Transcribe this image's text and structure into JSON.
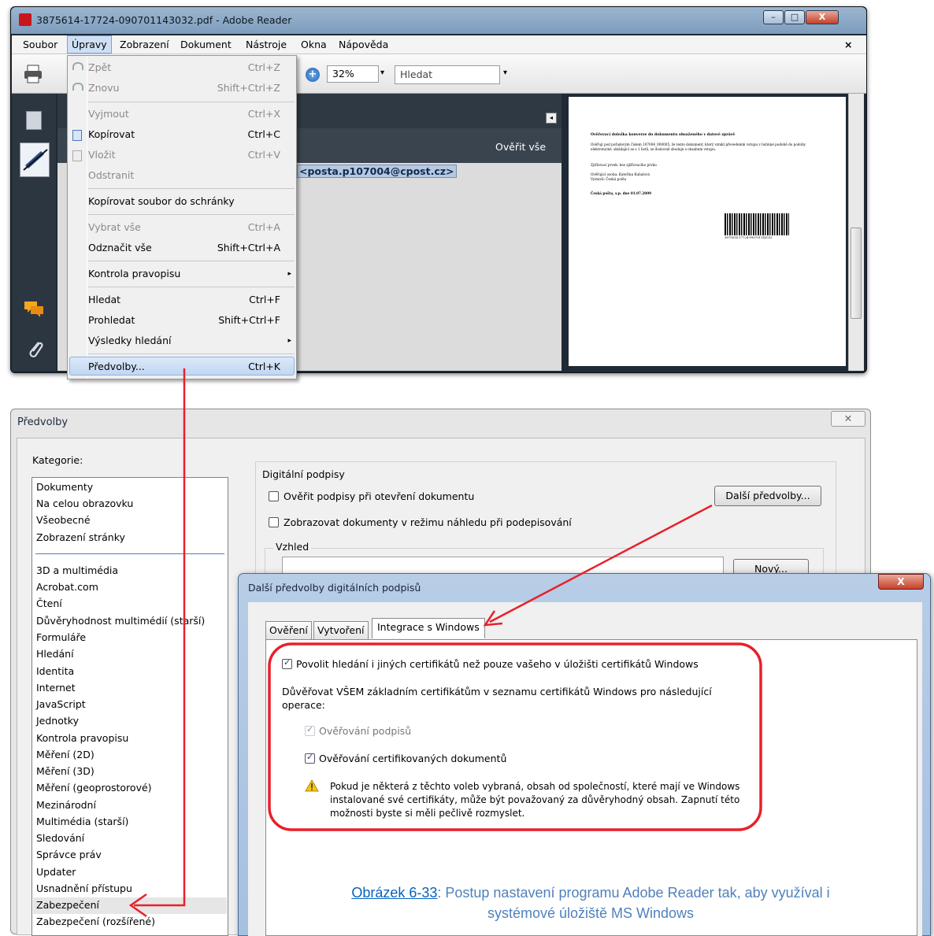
{
  "reader": {
    "title": "3875614-17724-090701143032.pdf - Adobe Reader",
    "controls": {
      "minimize": "–",
      "maximize": "□",
      "close": "X"
    },
    "menubar": [
      "Soubor",
      "Úpravy",
      "Zobrazení",
      "Dokument",
      "Nástroje",
      "Okna",
      "Nápověda"
    ],
    "doc_close": "×",
    "zoom": "32%",
    "search_placeholder": "Hledat",
    "verify_all": "Ověřit vše",
    "signer_email": "<posta.p107004@cpost.cz>",
    "pdf": {
      "heading": "Ověřovací doložka konverze do dokumentu obsaženého v datové zprávě",
      "para": "Ověřuji pod pořadovým číslem 107004_000005, že tento dokument, který vznikl převedením vstupu v listinné podobě do podoby elektronické, skládající se z 1 listů, se doslovně shoduje s obsahem vstupu.",
      "line1": "Zjišťovací prvek: bez zjišťovacího prvku",
      "line2": "Ověřující osoba: Kateřina Kubalová",
      "line3": "Vystavil: Česká pošta",
      "line4": "Česká pošta, s.p. dne 01.07.2009",
      "barcode": "3875614-17724-090701143032"
    }
  },
  "edit_menu": {
    "items": [
      {
        "label": "Zpět",
        "shortcut": "Ctrl+Z",
        "disabled": true
      },
      {
        "label": "Znovu",
        "shortcut": "Shift+Ctrl+Z",
        "disabled": true
      },
      {
        "label": "Vyjmout",
        "shortcut": "Ctrl+X",
        "disabled": true
      },
      {
        "label": "Kopírovat",
        "shortcut": "Ctrl+C",
        "disabled": false
      },
      {
        "label": "Vložit",
        "shortcut": "Ctrl+V",
        "disabled": true
      },
      {
        "label": "Odstranit",
        "shortcut": "",
        "disabled": true
      },
      {
        "label": "Kopírovat soubor do schránky",
        "shortcut": "",
        "disabled": false
      },
      {
        "label": "Vybrat vše",
        "shortcut": "Ctrl+A",
        "disabled": true
      },
      {
        "label": "Odznačit vše",
        "shortcut": "Shift+Ctrl+A",
        "disabled": false
      },
      {
        "label": "Kontrola pravopisu",
        "shortcut": "▸",
        "disabled": false
      },
      {
        "label": "Hledat",
        "shortcut": "Ctrl+F",
        "disabled": false
      },
      {
        "label": "Prohledat",
        "shortcut": "Shift+Ctrl+F",
        "disabled": false
      },
      {
        "label": "Výsledky hledání",
        "shortcut": "▸",
        "disabled": false
      },
      {
        "label": "Předvolby...",
        "shortcut": "Ctrl+K",
        "disabled": false
      }
    ]
  },
  "preferences": {
    "title": "Předvolby",
    "close": "✕",
    "categories_label": "Kategorie:",
    "categories_top": [
      "Dokumenty",
      "Na celou obrazovku",
      "Všeobecné",
      "Zobrazení stránky"
    ],
    "categories": [
      "3D a multimédia",
      "Acrobat.com",
      "Čtení",
      "Důvěryhodnost multimédií (starší)",
      "Formuláře",
      "Hledání",
      "Identita",
      "Internet",
      "JavaScript",
      "Jednotky",
      "Kontrola pravopisu",
      "Měření (2D)",
      "Měření (3D)",
      "Měření (geoprostorové)",
      "Mezinárodní",
      "Multimédia (starší)",
      "Sledování",
      "Správce práv",
      "Updater",
      "Usnadnění přístupu",
      "Zabezpečení",
      "Zabezpečení (rozšířené)"
    ],
    "group_title": "Digitální podpisy",
    "check1": "Ověřit podpisy při otevření dokumentu",
    "check2": "Zobrazovat dokumenty v režimu náhledu při podepisování",
    "more_button": "Další předvolby...",
    "appearance_label": "Vzhled",
    "new_button": "Nový..."
  },
  "more_dialog": {
    "title": "Další předvolby digitálních podpisů",
    "close": "X",
    "tabs": [
      "Ověření",
      "Vytvoření",
      "Integrace s Windows"
    ],
    "allow_search": "Povolit hledání i jiných certifikátů než pouze vašeho v úložišti certifikátů Windows",
    "trust_text": "Důvěřovat VŠEM základním certifikátům v seznamu certifikátů Windows pro následující operace:",
    "opt1": "Ověřování podpisů",
    "opt2": "Ověřování certifikovaných dokumentů",
    "warning": "Pokud je některá z těchto voleb vybraná, obsah od společností, které mají ve Windows instalované své certifikáty, může být považovaný za důvěryhodný obsah. Zapnutí této možnosti byste si měli pečlivě rozmyslet.",
    "caption_link": "Obrázek 6-33",
    "caption_rest": ": Postup nastavení programu Adobe Reader tak, aby využíval i systémové úložiště MS Windows"
  },
  "colors": {
    "annotation": "#e8202a",
    "caption": "#4f81bd",
    "link": "#0563c1"
  }
}
